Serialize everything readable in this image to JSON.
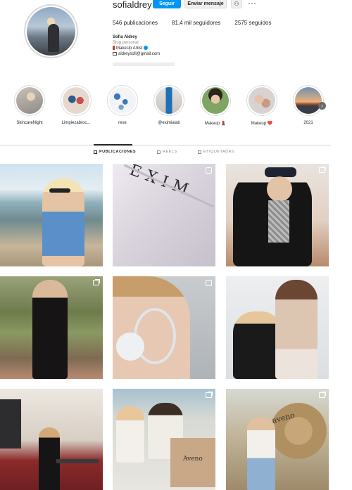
{
  "profile": {
    "username": "sofialdrey",
    "follow_label": "Seguir",
    "message_label": "Enviar mensaje",
    "more_label": "···",
    "stats": {
      "posts": "546 publicaciones",
      "followers": "81,4 mil seguidores",
      "following": "2575 seguidos"
    },
    "bio": {
      "name": "Sofia Aldrey",
      "category": "Blog personal",
      "line1": "MakeUp Artist",
      "email": "aldreysofi@gmail.com"
    }
  },
  "highlights": [
    {
      "label": "SkincareNight"
    },
    {
      "label": "Limpiezabroc..."
    },
    {
      "label": "rese"
    },
    {
      "label": "@eximialab"
    },
    {
      "label": "Makeup 💄"
    },
    {
      "label": "Makeup ❤️"
    },
    {
      "label": "2021"
    }
  ],
  "tabs": [
    {
      "label": "PUBLICACIONES",
      "icon": "grid-icon",
      "active": true
    },
    {
      "label": "REELS",
      "icon": "reels-icon",
      "active": false
    },
    {
      "label": "ETIQUETADAS",
      "icon": "tagged-icon",
      "active": false
    }
  ],
  "posts": [
    {
      "text": ""
    },
    {
      "text": "EXIM"
    },
    {
      "text": ""
    },
    {
      "text": ""
    },
    {
      "text": ""
    },
    {
      "text": ""
    },
    {
      "text": ""
    },
    {
      "text": "Aveno"
    },
    {
      "text": "aveno"
    }
  ],
  "colors": {
    "accent": "#0095f6",
    "text": "#262626",
    "muted": "#8e8e8e",
    "border": "#dbdbdb"
  }
}
